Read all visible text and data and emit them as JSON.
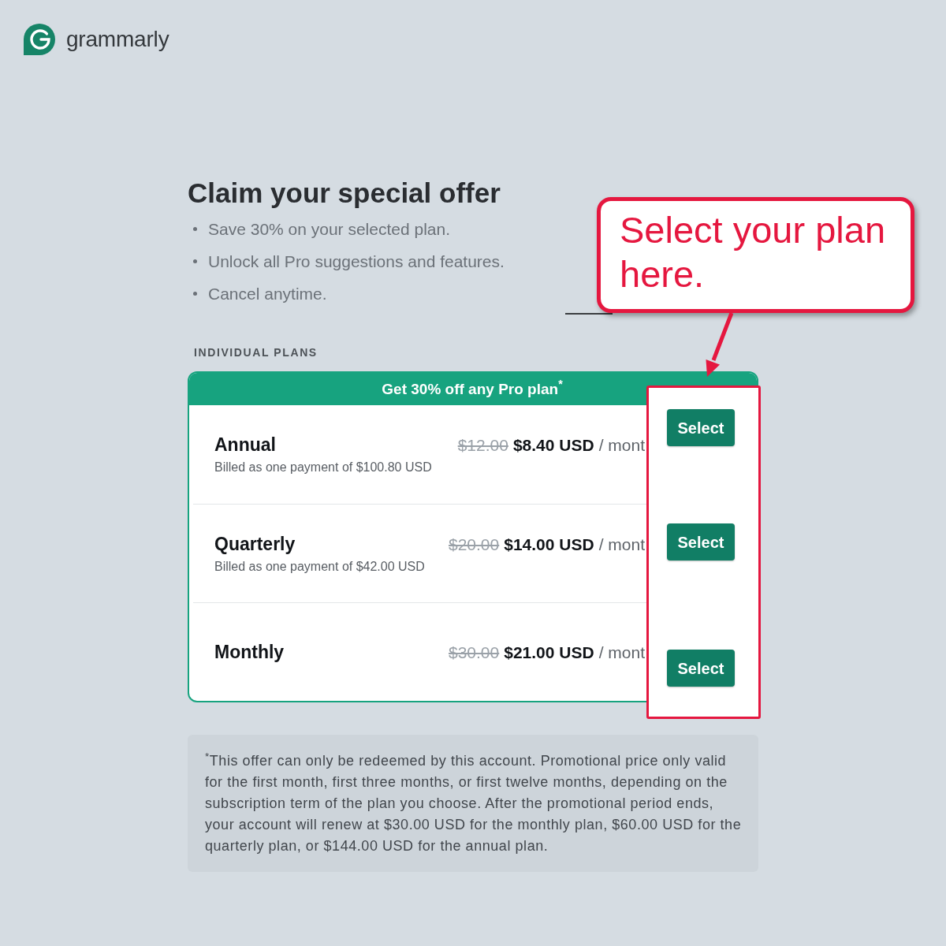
{
  "logo": {
    "wordmark": "grammarly"
  },
  "offer": {
    "title": "Claim your special offer",
    "bullets": [
      "Save 30% on your selected plan.",
      "Unlock all Pro suggestions and features.",
      "Cancel anytime."
    ]
  },
  "plans": {
    "section_label": "INDIVIDUAL PLANS",
    "banner": "Get 30% off any Pro plan$^{*}$",
    "rows": [
      {
        "name": "Annual",
        "billing": "Billed as one payment of $100.80 USD",
        "old_price": "$12.00",
        "price": "$8.40 USD",
        "period": "/ mont",
        "button": "Select"
      },
      {
        "name": "Quarterly",
        "billing": "Billed as one payment of $42.00 USD",
        "old_price": "$20.00",
        "price": "$14.00 USD",
        "period": "/ mont",
        "button": "Select"
      },
      {
        "name": "Monthly",
        "old_price": "$30.00",
        "price": "$21.00 USD",
        "period": "/ mont",
        "button": "Select"
      }
    ]
  },
  "footnote": "$^{*}$This offer can only be redeemed by this account. Promotional price only valid for the first month, first three months, or first twelve months, depending on the subscription term of the plan you choose. After the promotional period ends, your account will renew at $30.00 USD for the monthly plan, $60.00 USD for the quarterly plan, or $144.00 USD for the annual plan.",
  "callout": {
    "text": "Select your plan here."
  }
}
